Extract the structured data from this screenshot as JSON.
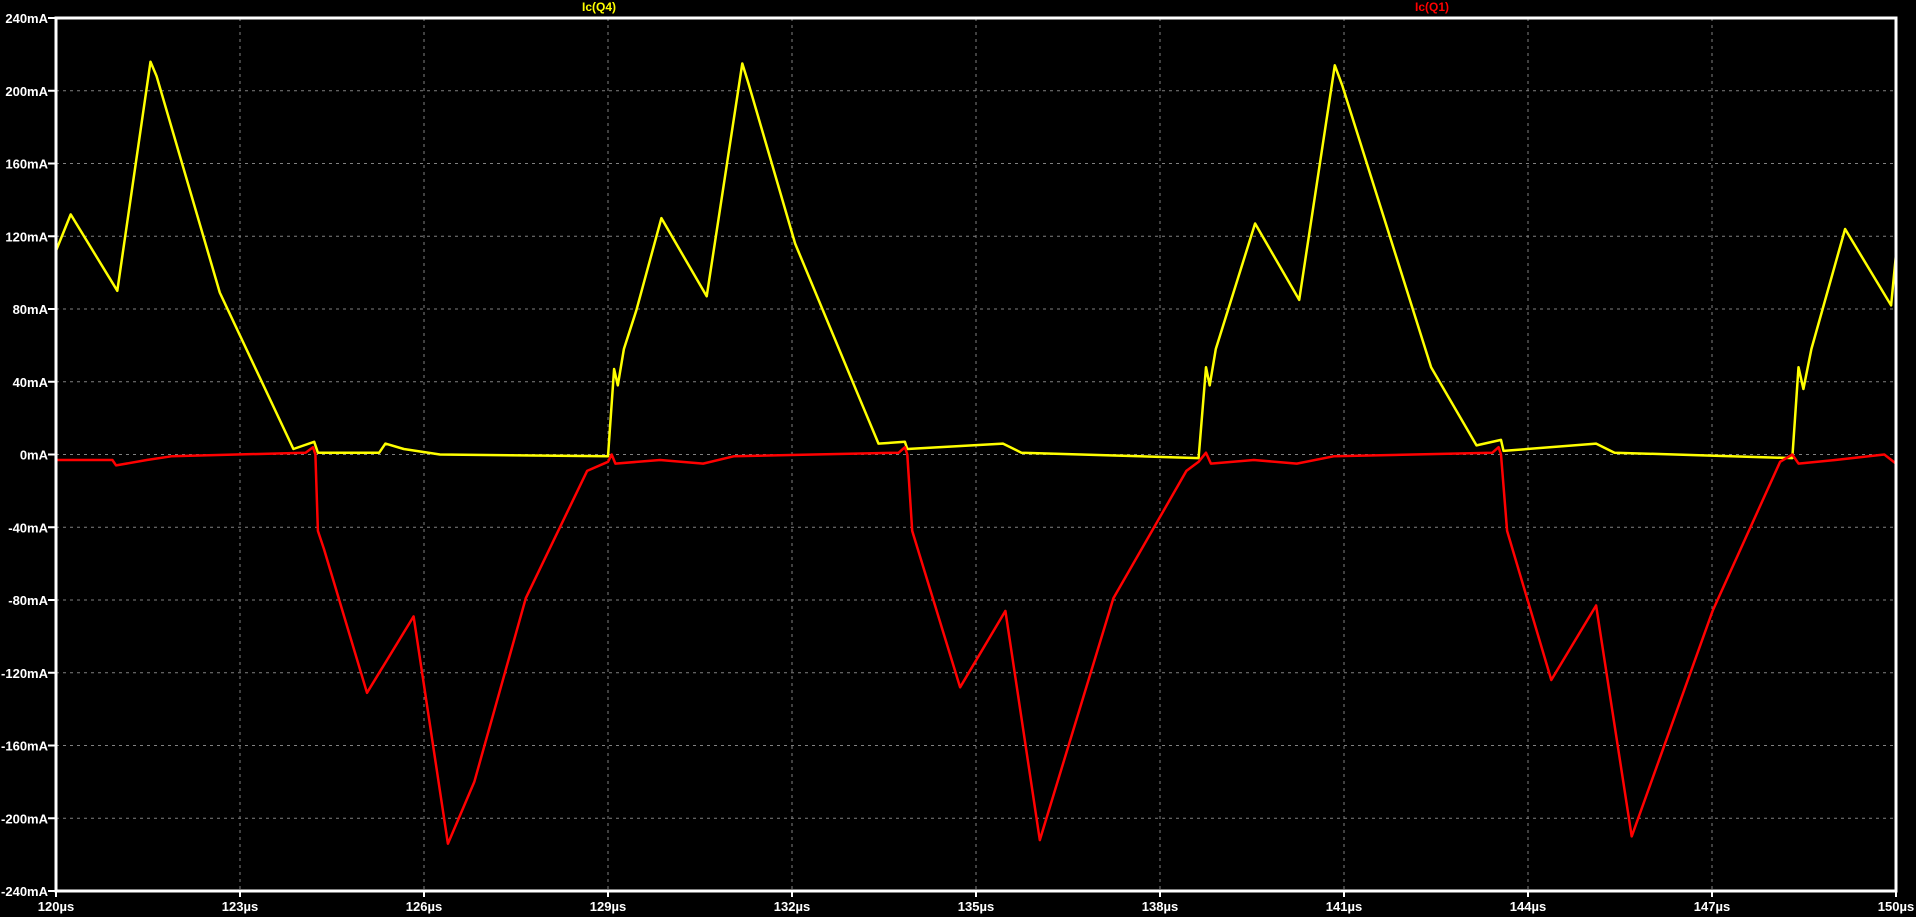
{
  "chart_data": {
    "type": "line",
    "title": "",
    "xlabel": "",
    "ylabel": "",
    "xlim": [
      120,
      150
    ],
    "ylim": [
      -240,
      240
    ],
    "x_unit": "µs",
    "y_unit": "mA",
    "grid": true,
    "background": "#000000",
    "x_ticks": [
      "120µs",
      "123µs",
      "126µs",
      "129µs",
      "132µs",
      "135µs",
      "138µs",
      "141µs",
      "144µs",
      "147µs",
      "150µs"
    ],
    "y_ticks": [
      "240mA",
      "200mA",
      "160mA",
      "120mA",
      "80mA",
      "40mA",
      "0mA",
      "-40mA",
      "-80mA",
      "-120mA",
      "-160mA",
      "-200mA",
      "-240mA"
    ],
    "legend_placement": "top",
    "series": [
      {
        "name": "Ic(Q4)",
        "color": "#ffff00",
        "points": [
          [
            120.0,
            112
          ],
          [
            120.24,
            132
          ],
          [
            121.0,
            90
          ],
          [
            121.54,
            216
          ],
          [
            121.64,
            208
          ],
          [
            122.67,
            89
          ],
          [
            123.87,
            3
          ],
          [
            124.21,
            7
          ],
          [
            124.27,
            1
          ],
          [
            125.27,
            1
          ],
          [
            125.37,
            6
          ],
          [
            125.67,
            3
          ],
          [
            126.26,
            0
          ],
          [
            129.0,
            -1
          ],
          [
            129.1,
            47
          ],
          [
            129.16,
            38
          ],
          [
            129.26,
            58
          ],
          [
            129.46,
            79
          ],
          [
            129.87,
            130
          ],
          [
            130.61,
            87
          ],
          [
            131.19,
            215
          ],
          [
            131.29,
            204
          ],
          [
            132.05,
            116
          ],
          [
            133.05,
            35
          ],
          [
            133.41,
            6
          ],
          [
            133.84,
            7
          ],
          [
            133.88,
            3
          ],
          [
            135.44,
            6
          ],
          [
            135.74,
            1
          ],
          [
            138.63,
            -2
          ],
          [
            138.75,
            48
          ],
          [
            138.81,
            38
          ],
          [
            138.91,
            58
          ],
          [
            139.55,
            127
          ],
          [
            140.27,
            85
          ],
          [
            140.85,
            214
          ],
          [
            140.97,
            203
          ],
          [
            142.42,
            48
          ],
          [
            143.16,
            5
          ],
          [
            143.56,
            8
          ],
          [
            143.6,
            2
          ],
          [
            145.11,
            6
          ],
          [
            145.41,
            1
          ],
          [
            148.31,
            -2
          ],
          [
            148.41,
            48
          ],
          [
            148.49,
            36
          ],
          [
            148.62,
            58
          ],
          [
            149.17,
            124
          ],
          [
            149.92,
            82
          ],
          [
            150.0,
            110
          ]
        ]
      },
      {
        "name": "Ic(Q1)",
        "color": "#ff0000",
        "points": [
          [
            120.0,
            -3
          ],
          [
            120.92,
            -3
          ],
          [
            120.98,
            -6
          ],
          [
            121.48,
            -3
          ],
          [
            121.88,
            -1
          ],
          [
            124.07,
            1
          ],
          [
            124.19,
            4
          ],
          [
            124.23,
            0
          ],
          [
            124.27,
            -42
          ],
          [
            124.37,
            -52
          ],
          [
            125.07,
            -131
          ],
          [
            125.83,
            -89
          ],
          [
            126.39,
            -214
          ],
          [
            126.82,
            -180
          ],
          [
            127.66,
            -79
          ],
          [
            128.66,
            -9
          ],
          [
            129.0,
            -4
          ],
          [
            129.06,
            0
          ],
          [
            129.12,
            -5
          ],
          [
            129.85,
            -3
          ],
          [
            130.55,
            -5
          ],
          [
            131.05,
            -1
          ],
          [
            133.74,
            1
          ],
          [
            133.84,
            4
          ],
          [
            133.88,
            0
          ],
          [
            133.96,
            -42
          ],
          [
            134.74,
            -128
          ],
          [
            135.48,
            -86
          ],
          [
            136.04,
            -212
          ],
          [
            137.24,
            -79
          ],
          [
            138.43,
            -9
          ],
          [
            138.63,
            -4
          ],
          [
            138.75,
            1
          ],
          [
            138.83,
            -5
          ],
          [
            139.53,
            -3
          ],
          [
            140.23,
            -5
          ],
          [
            140.83,
            -1
          ],
          [
            143.42,
            1
          ],
          [
            143.52,
            4
          ],
          [
            143.56,
            0
          ],
          [
            143.66,
            -42
          ],
          [
            144.38,
            -124
          ],
          [
            145.11,
            -83
          ],
          [
            145.69,
            -210
          ],
          [
            147.01,
            -86
          ],
          [
            148.11,
            -4
          ],
          [
            148.31,
            0
          ],
          [
            148.41,
            -5
          ],
          [
            149.01,
            -3
          ],
          [
            149.81,
            0
          ],
          [
            150.0,
            -5
          ]
        ]
      }
    ]
  }
}
